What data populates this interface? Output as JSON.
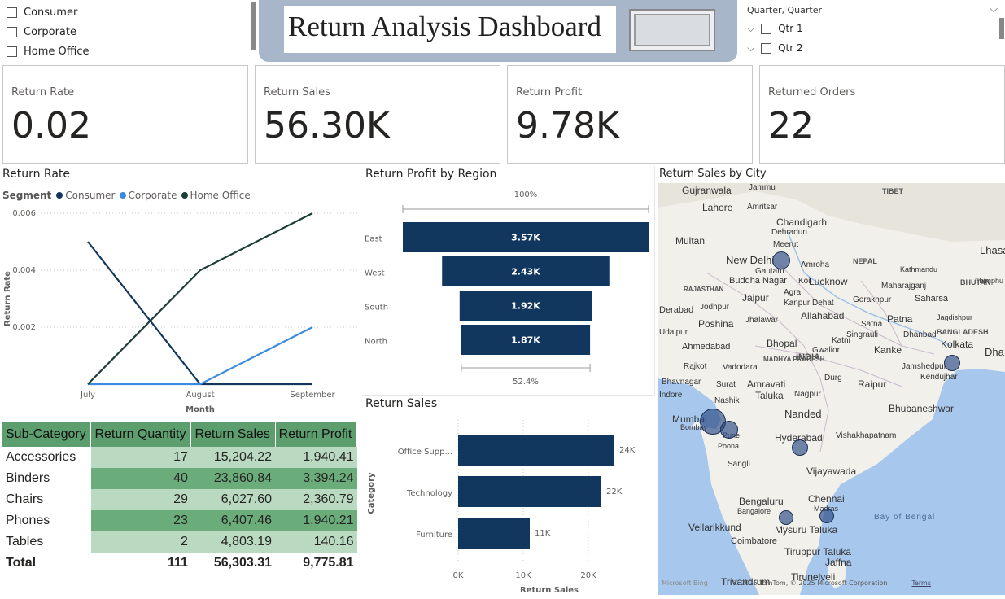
{
  "segment_slicer": {
    "items": [
      "Consumer",
      "Corporate",
      "Home Office"
    ]
  },
  "header": {
    "title": "Return Analysis Dashboard"
  },
  "quarter_slicer": {
    "title": "Quarter, Quarter",
    "items": [
      "Qtr 1",
      "Qtr 2"
    ]
  },
  "cards": [
    {
      "label": "Return Rate",
      "value": "0.02"
    },
    {
      "label": "Return Sales",
      "value": "56.30K"
    },
    {
      "label": "Return Profit",
      "value": "9.78K"
    },
    {
      "label": "Returned Orders",
      "value": "22"
    }
  ],
  "line_chart": {
    "title": "Return Rate",
    "legend_title": "Segment",
    "xlabel": "Month",
    "ylabel": "Return Rate",
    "y_ticks": [
      "0.006",
      "0.004",
      "0.002"
    ],
    "x_ticks": [
      "July",
      "August",
      "September"
    ]
  },
  "funnel": {
    "title": "Return Profit by Region",
    "top_pct": "100%",
    "bottom_pct": "52.4%"
  },
  "bar_chart": {
    "title": "Return Sales",
    "xlabel": "Return Sales",
    "ylabel": "Category",
    "x_ticks": [
      "0K",
      "10K",
      "20K"
    ]
  },
  "map": {
    "title": "Return Sales by City",
    "attribution": "© 2025 TomTom, © 2025 Microsoft Corporation",
    "terms": "Terms",
    "bing": "Microsoft Bing",
    "labels": [
      "Gujranwala",
      "Jammu",
      "Lahore",
      "Amritsar",
      "Chandigarh",
      "Multan",
      "TIBET",
      "Meerut",
      "New Delhi",
      "Gautam",
      "Buddha Nagar",
      "Amroha",
      "NEPAL",
      "Kathmandu",
      "Lucknow",
      "Koil",
      "Agra",
      "RAJASTHAN",
      "Jaipur",
      "Kanpur Dehat",
      "Gorakhpur",
      "Maharajganj",
      "Saharsa",
      "BHUTAN",
      "Jodhpur",
      "Allahabad",
      "Patna",
      "Jagdishpur",
      "Poshina",
      "Jhalawar",
      "Satna",
      "Singrauli",
      "Dhanbad",
      "BANGLADESH",
      "Ahmedabad",
      "Bhopal",
      "Katni",
      "Kanke",
      "Kolkata",
      "Dha",
      "Rajkot",
      "Vadodara",
      "MADHYA PRADESH",
      "INDIA",
      "Jamshedpur",
      "Kendujhar",
      "Bhavnagar",
      "Surat",
      "Amravati",
      "Durg",
      "Raipur",
      "Taluka",
      "Nagpur",
      "Nashik",
      "Bhubaneshwar",
      "Mumbai",
      "Bombay",
      "Pune",
      "Nanded",
      "Poona",
      "Hyderabad",
      "Vishakhapatnam",
      "Sangli",
      "Vijayawada",
      "Bengaluru",
      "Bangalore",
      "Chennai",
      "Madras",
      "Bay of Bengal",
      "Vellarikkund",
      "Mysuru Taluka",
      "Coimbatore",
      "Tiruppur Taluka",
      "Jaffna",
      "Trivandrum",
      "Tirunelveli",
      "Udaipur",
      "Indore",
      "Lhasa",
      "Gwalior",
      "Dehradun",
      "Derabad",
      "Thimphu"
    ]
  },
  "chart_data": [
    {
      "type": "line",
      "title": "Return Rate",
      "xlabel": "Month",
      "ylabel": "Return Rate",
      "x": [
        "July",
        "August",
        "September"
      ],
      "ylim": [
        0,
        0.006
      ],
      "legend_title": "Segment",
      "legend_placement": "top-left",
      "series": [
        {
          "name": "Consumer",
          "values": [
            0.005,
            0.0,
            0.0
          ],
          "color": "#12355b"
        },
        {
          "name": "Corporate",
          "values": [
            0.0,
            0.0,
            0.002
          ],
          "color": "#3a8be0"
        },
        {
          "name": "Home Office",
          "values": [
            0.0,
            0.004,
            0.006
          ],
          "color": "#1c3d3a"
        }
      ]
    },
    {
      "type": "bar",
      "subtype": "funnel",
      "title": "Return Profit by Region",
      "categories": [
        "East",
        "West",
        "South",
        "North"
      ],
      "values": [
        3570,
        2430,
        1920,
        1870
      ],
      "labels": [
        "3.57K",
        "2.43K",
        "1.92K",
        "1.87K"
      ],
      "color": "#12375f"
    },
    {
      "type": "bar",
      "orientation": "horizontal",
      "title": "Return Sales",
      "xlabel": "Return Sales",
      "ylabel": "Category",
      "categories": [
        "Office Supp...",
        "Technology",
        "Furniture"
      ],
      "values": [
        24000,
        22000,
        11000
      ],
      "labels": [
        "24K",
        "22K",
        "11K"
      ],
      "xlim": [
        0,
        25000
      ],
      "color": "#12375f"
    },
    {
      "type": "table",
      "columns": [
        "Sub-Category",
        "Return Quantity",
        "Return Sales",
        "Return Profit"
      ],
      "rows": [
        [
          "Accessories",
          "17",
          "15,204.22",
          "1,940.41"
        ],
        [
          "Binders",
          "40",
          "23,860.84",
          "3,394.24"
        ],
        [
          "Chairs",
          "29",
          "6,027.60",
          "2,360.79"
        ],
        [
          "Phones",
          "23",
          "6,407.46",
          "1,940.21"
        ],
        [
          "Tables",
          "2",
          "4,803.19",
          "140.16"
        ]
      ],
      "total": [
        "Total",
        "111",
        "56,303.31",
        "9,775.81"
      ]
    }
  ],
  "colors": {
    "header_bg": "#a7b6c8",
    "table_header": "#5c9e6e",
    "table_light": "#b9dac0",
    "table_dark": "#6bac7b",
    "bar_color": "#12375f",
    "map_water": "#a7c8ec",
    "map_land": "#f2f0eb",
    "bubble": "#3e5f9a"
  }
}
